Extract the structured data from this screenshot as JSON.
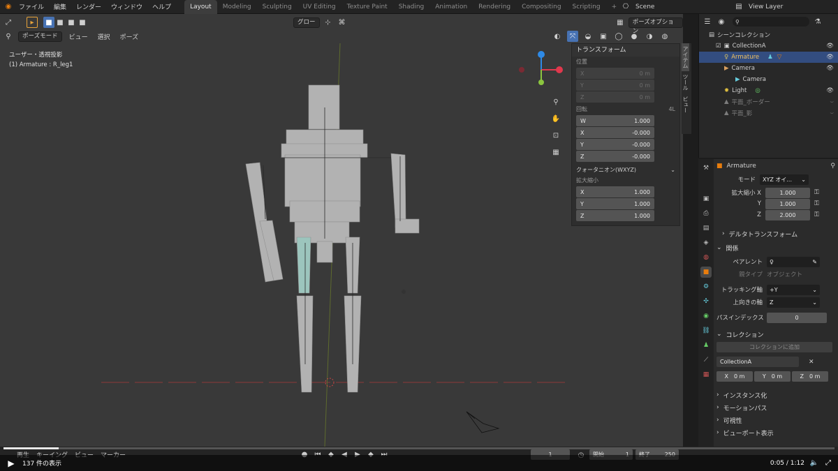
{
  "topbar": {
    "menus": [
      "ファイル",
      "編集",
      "レンダー",
      "ウィンドウ",
      "ヘルプ"
    ],
    "workspaces": [
      "Layout",
      "Modeling",
      "Sculpting",
      "UV Editing",
      "Texture Paint",
      "Shading",
      "Animation",
      "Rendering",
      "Compositing",
      "Scripting"
    ],
    "active_workspace": "Layout",
    "add_workspace": "+",
    "scene": "Scene",
    "view_layer": "View Layer"
  },
  "viewport_header": {
    "mode": "ポーズモード",
    "menus": [
      "ビュー",
      "選択",
      "ポーズ"
    ],
    "orientation": "グロー",
    "pose_options": "ポーズオプション"
  },
  "overlay": {
    "view_name": "ユーザー・透視投影",
    "active_object": "(1) Armature : R_leg1"
  },
  "npanel": {
    "title": "トランスフォーム",
    "location_label": "位置",
    "location": [
      {
        "axis": "X",
        "value": "0 m"
      },
      {
        "axis": "Y",
        "value": "0 m"
      },
      {
        "axis": "Z",
        "value": "0 m"
      }
    ],
    "rotation_label": "回転",
    "rotation_mode_short": "4L",
    "rotation": [
      {
        "axis": "W",
        "value": "1.000"
      },
      {
        "axis": "X",
        "value": "-0.000"
      },
      {
        "axis": "Y",
        "value": "-0.000"
      },
      {
        "axis": "Z",
        "value": "-0.000"
      }
    ],
    "quaternion_mode": "クォータニオン(WXYZ)",
    "scale_label": "拡大縮小",
    "scale": [
      {
        "axis": "X",
        "value": "1.000"
      },
      {
        "axis": "Y",
        "value": "1.000"
      },
      {
        "axis": "Z",
        "value": "1.000"
      }
    ],
    "side_tabs": [
      "アイテム",
      "ツール",
      "ビュー"
    ]
  },
  "outliner": {
    "title": "シーンコレクション",
    "items": [
      {
        "label": "CollectionA",
        "indent": 1
      },
      {
        "label": "Armature",
        "indent": 2,
        "selected": true
      },
      {
        "label": "Camera",
        "indent": 2
      },
      {
        "label": "Camera",
        "indent": 3
      },
      {
        "label": "Light",
        "indent": 2
      },
      {
        "label": "平面_ボーダー",
        "indent": 2
      },
      {
        "label": "平面_影",
        "indent": 2
      }
    ]
  },
  "properties": {
    "object_name": "Armature",
    "mode_label": "モード",
    "mode_value": "XYZ オイ...",
    "scale_label": "拡大縮小 X",
    "scale_x": "1.000",
    "scale_y_label": "Y",
    "scale_y": "1.000",
    "scale_z_label": "Z",
    "scale_z": "2.000",
    "delta_transform": "デルタトランスフォーム",
    "relations": "関係",
    "parent_label": "ペアレント",
    "parent_type_label": "親タイプ",
    "parent_type_value": "オブジェクト",
    "tracking_axis_label": "トラッキング軸",
    "tracking_axis_value": "+Y",
    "up_axis_label": "上向きの軸",
    "up_axis_value": "Z",
    "pass_index_label": "パスインデックス",
    "pass_index_value": "0",
    "collections": "コレクション",
    "add_to_collection": "コレクションに追加",
    "collection_name": "CollectionA",
    "offset": [
      {
        "axis": "X",
        "value": "0 m"
      },
      {
        "axis": "Y",
        "value": "0 m"
      },
      {
        "axis": "Z",
        "value": "0 m"
      }
    ],
    "instancing": "インスタンス化",
    "motion_paths": "モーションパス",
    "visibility": "可視性",
    "viewport_display": "ビューポート表示"
  },
  "timeline": {
    "menus": [
      "再生",
      "キーイング",
      "ビュー",
      "マーカー"
    ],
    "current_frame": "1",
    "start_label": "開始",
    "start": "1",
    "end_label": "終了",
    "end": "250"
  },
  "video": {
    "count_text": "137 件の表示",
    "time": "0:05 / 1:12"
  },
  "colors": {
    "accent": "#4772b3",
    "viewport_bg": "#393939",
    "selected_row": "#334d80",
    "axis_red": "#e0384d",
    "axis_green": "#8bc53f",
    "axis_blue": "#2e8ae6"
  }
}
